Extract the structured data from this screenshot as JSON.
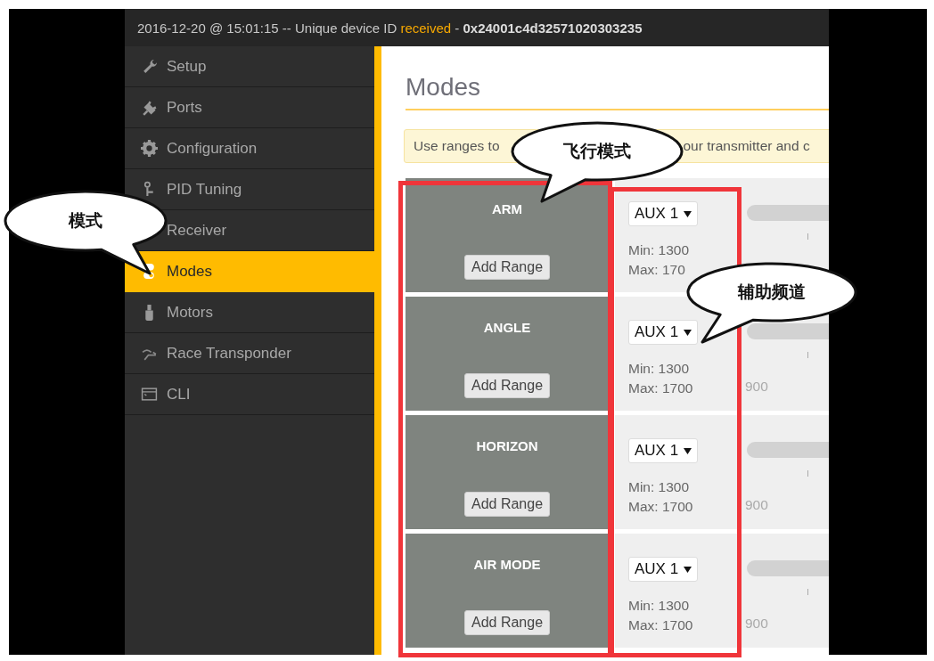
{
  "status_bar": {
    "prefix": "2016-12-20 @ 15:01:15 -- Unique device ID ",
    "highlight": "received",
    "suffix": " - **0x24001c4d32571020303235**"
  },
  "sidebar": {
    "items": [
      {
        "label": "Setup",
        "selected": false
      },
      {
        "label": "Ports",
        "selected": false
      },
      {
        "label": "Configuration",
        "selected": false
      },
      {
        "label": "PID Tuning",
        "selected": false
      },
      {
        "label": "Receiver",
        "selected": false
      },
      {
        "label": "Modes",
        "selected": true
      },
      {
        "label": "Motors",
        "selected": false
      },
      {
        "label": "Race Transponder",
        "selected": false
      },
      {
        "label": "CLI",
        "selected": false
      }
    ]
  },
  "page": {
    "title": "Modes",
    "notice": [
      "Use ranges to",
      "our transmitter and c"
    ]
  },
  "modes": [
    {
      "name": "ARM",
      "button": "Add Range",
      "channel": "AUX 1",
      "min": "Min: 1300",
      "max": "Max: 170"
    },
    {
      "name": "ANGLE",
      "button": "Add Range",
      "channel": "AUX 1",
      "min": "Min: 1300",
      "max": "Max: 1700",
      "scale_label": "900"
    },
    {
      "name": "HORIZON",
      "button": "Add Range",
      "channel": "AUX 1",
      "min": "Min: 1300",
      "max": "Max: 1700",
      "scale_label": "900"
    },
    {
      "name": "AIR MODE",
      "button": "Add Range",
      "channel": "AUX 1",
      "min": "Min: 1300",
      "max": "Max: 1700",
      "scale_label": "900"
    }
  ],
  "annotations": [
    {
      "text": "模式"
    },
    {
      "text": "飞行模式"
    },
    {
      "text": "辅助频道"
    }
  ]
}
